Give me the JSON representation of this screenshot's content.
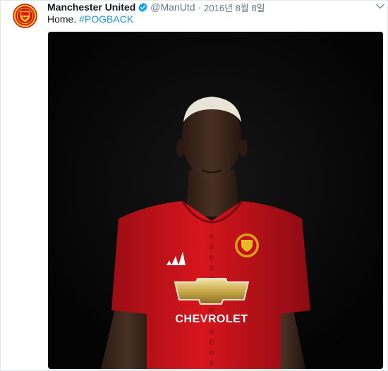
{
  "tweet": {
    "author_name": "Manchester United",
    "handle": "@ManUtd",
    "separator": "·",
    "date": "2016년 8월 8일",
    "text": "Home.",
    "hashtag": "#POGBACK"
  },
  "media": {
    "shirt_sponsor": "CHEVROLET"
  },
  "colors": {
    "link": "#1b95e0",
    "verified": "#1da1f2",
    "club_red": "#d7151d",
    "background": "#050505"
  },
  "icons": [
    "club-crest-icon",
    "verified-badge-icon",
    "chevron-down-icon",
    "brand-logo-icon",
    "sponsor-bowtie-icon"
  ]
}
